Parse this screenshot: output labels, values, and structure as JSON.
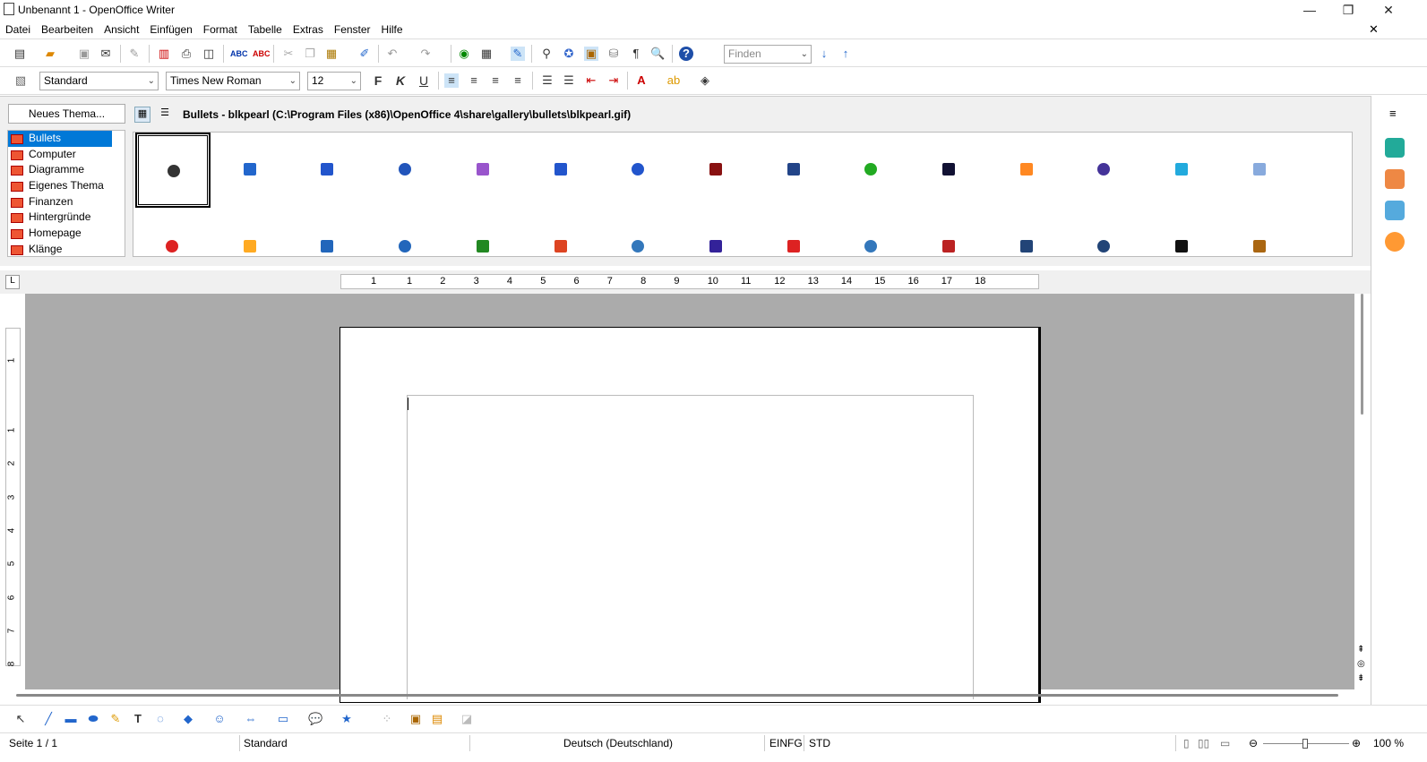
{
  "window": {
    "title": "Unbenannt 1 - OpenOffice Writer",
    "minimize": "—",
    "maximize": "❐",
    "close": "✕",
    "doc_close": "✕"
  },
  "menu": [
    "Datei",
    "Bearbeiten",
    "Ansicht",
    "Einfügen",
    "Format",
    "Tabelle",
    "Extras",
    "Fenster",
    "Hilfe"
  ],
  "toolbar": {
    "find_placeholder": "Finden"
  },
  "formatting": {
    "style": "Standard",
    "font": "Times New Roman",
    "size": "12",
    "bold": "F",
    "italic": "K",
    "underline": "U"
  },
  "gallery": {
    "new_theme_label": "Neues Thema...",
    "path": "Bullets - blkpearl (C:\\Program Files (x86)\\OpenOffice 4\\share\\gallery\\bullets\\blkpearl.gif)",
    "themes": [
      "Bullets",
      "Computer",
      "Diagramme",
      "Eigenes Thema",
      "Finanzen",
      "Hintergründe",
      "Homepage",
      "Klänge"
    ],
    "selected_theme": "Bullets",
    "row1_colors": [
      "#333333",
      "#2266cc",
      "#2255cc",
      "#2255bb",
      "#9955cc",
      "#2255cc",
      "#2255cc",
      "#881111",
      "#224488",
      "#22aa22",
      "#111133",
      "#ff8822",
      "#443399",
      "#22aadd",
      "#88aadd"
    ],
    "row2_colors": [
      "#dd2222",
      "#ffaa22",
      "#2266bb",
      "#2266bb",
      "#228822",
      "#dd4422",
      "#3377bb",
      "#332299",
      "#dd2222",
      "#3377bb",
      "#bb2222",
      "#224477",
      "#224477",
      "#111111",
      "#aa6611"
    ]
  },
  "ruler": {
    "h_numbers": [
      "1",
      "1",
      "2",
      "3",
      "4",
      "5",
      "6",
      "7",
      "8",
      "9",
      "10",
      "11",
      "12",
      "13",
      "14",
      "15",
      "16",
      "17",
      "18"
    ],
    "v_numbers": [
      "1",
      "1",
      "2",
      "3",
      "4",
      "5",
      "6",
      "7",
      "8"
    ]
  },
  "status": {
    "page": "Seite 1 / 1",
    "style": "Standard",
    "language": "Deutsch (Deutschland)",
    "insert_mode": "EINFG",
    "selection_mode": "STD",
    "zoom": "100 %"
  }
}
